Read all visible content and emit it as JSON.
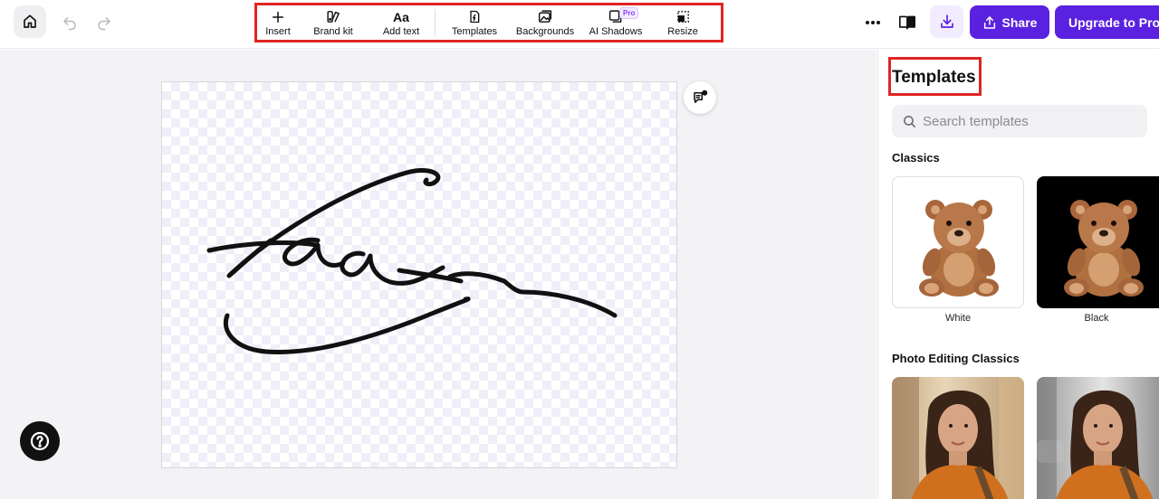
{
  "toolbar": {
    "insert": "Insert",
    "brand_kit": "Brand kit",
    "add_text": "Add text",
    "add_text_glyph": "Aa",
    "templates": "Templates",
    "backgrounds": "Backgrounds",
    "ai_shadows": "AI Shadows",
    "pro_badge": "Pro",
    "resize": "Resize"
  },
  "header": {
    "share": "Share",
    "upgrade": "Upgrade to Pro"
  },
  "panel": {
    "title": "Templates",
    "search_placeholder": "Search templates",
    "sections": [
      {
        "title": "Classics",
        "items": [
          {
            "label": "White",
            "bg": "#ffffff"
          },
          {
            "label": "Black",
            "bg": "#000000"
          }
        ]
      },
      {
        "title": "Photo Editing Classics"
      }
    ]
  },
  "colors": {
    "accent": "#5b21e0",
    "highlight": "#e02424"
  }
}
